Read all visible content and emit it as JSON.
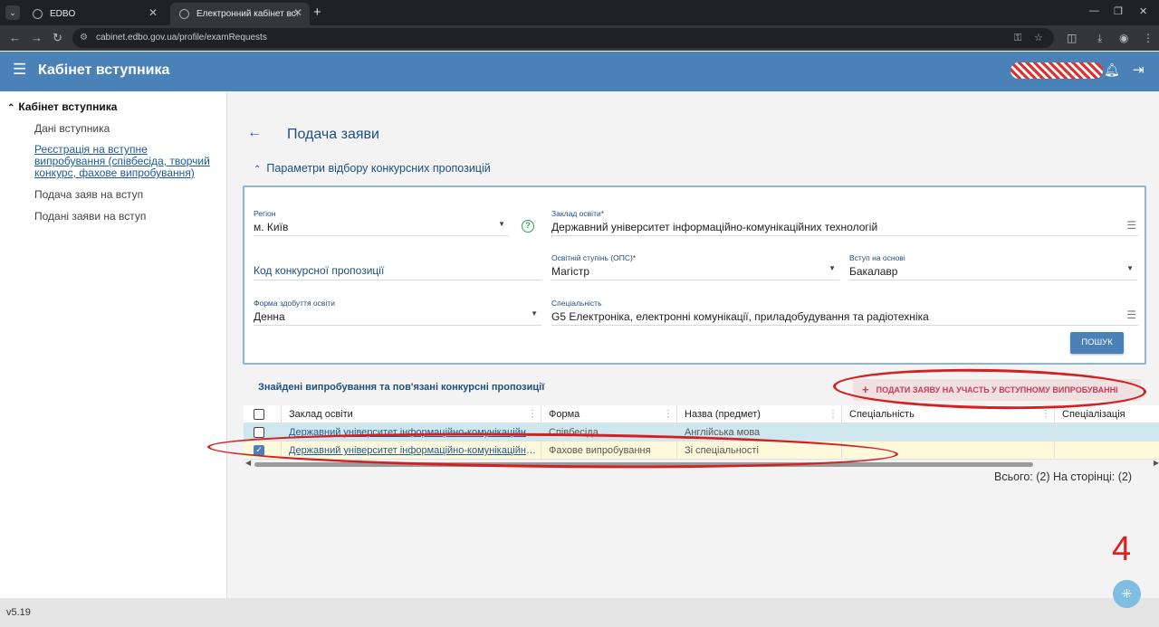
{
  "browser": {
    "tabs": [
      {
        "title": "EDBO"
      },
      {
        "title": "Електронний кабінет вступника"
      }
    ],
    "url": "cabinet.edbo.gov.ua/profile/examRequests"
  },
  "app": {
    "title": "Кабінет вступника",
    "version": "v5.19"
  },
  "sidebar": {
    "heading": "Кабінет вступника",
    "items": [
      {
        "label": "Дані вступника"
      },
      {
        "label_lines": [
          "Реєстрація на вступне",
          "випробування (співбесіда, творчий",
          "конкурс, фахове випробування)"
        ]
      },
      {
        "label": "Подача заяв на вступ"
      },
      {
        "label": "Подані заяви на вступ"
      }
    ]
  },
  "page": {
    "title": "Подача заяви",
    "section_title": "Параметри відбору конкурсних пропозицій"
  },
  "filters": {
    "region": {
      "label": "Регіон",
      "value": "м. Київ"
    },
    "institution": {
      "label": "Заклад освіти*",
      "value": "Державний університет інформаційно-комунікаційних технологій"
    },
    "offer_code": {
      "placeholder": "Код конкурсної пропозиції"
    },
    "degree": {
      "label": "Освітній ступінь (ОПС)*",
      "value": "Магістр"
    },
    "basis": {
      "label": "Вступ на основі",
      "value": "Бакалавр"
    },
    "study_form": {
      "label": "Форма здобуття освіти",
      "value": "Денна"
    },
    "specialty": {
      "label": "Спеціальність",
      "value": "G5 Електроніка, електронні комунікації, приладобудування та радіотехніка"
    },
    "search_label": "ПОШУК"
  },
  "results": {
    "title": "Знайдені випробування та пов'язані конкурсні пропозиції",
    "apply_label": "ПОДАТИ ЗАЯВУ НА УЧАСТЬ У ВСТУПНОМУ ВИПРОБУВАННІ",
    "columns": [
      "Заклад освіти",
      "Форма",
      "Назва (предмет)",
      "Спеціальність",
      "Спеціалізація"
    ],
    "rows": [
      {
        "institution": "Державний університет інформаційно-комунікаційних технологій",
        "form": "Співбесіда",
        "subject": "Англійська мова",
        "specialty": "",
        "specialization": "",
        "checked": false
      },
      {
        "institution": "Державний університет інформаційно-комунікаційних технологій",
        "form": "Фахове випробування",
        "subject": "Зі спеціальності",
        "specialty": "",
        "specialization": "",
        "checked": true
      }
    ],
    "totals": "Всього: (2) На сторінці: (2)"
  },
  "annotation": {
    "step": "4",
    "color": "#d42020"
  },
  "colors": {
    "header": "#4a82b8",
    "accent": "#1e4f80",
    "selected_row": "#fff9db",
    "highlight_row": "#cfe8ef"
  }
}
